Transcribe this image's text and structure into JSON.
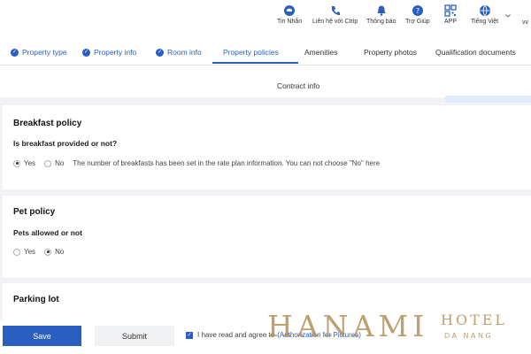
{
  "topbar": {
    "items": [
      {
        "label": "Tin Nhắn",
        "icon": "chat-icon"
      },
      {
        "label": "Liên hệ với Ctrip",
        "icon": "phone-icon"
      },
      {
        "label": "Thông báo",
        "icon": "bell-icon"
      },
      {
        "label": "Trợ Giúp",
        "icon": "help-icon"
      },
      {
        "label": "APP",
        "icon": "qr-code-icon"
      },
      {
        "label": "Tiếng Việt",
        "icon": "globe-icon"
      }
    ],
    "extra": "vv"
  },
  "tabs": [
    {
      "label": "Property type",
      "completed": true
    },
    {
      "label": "Property info",
      "completed": true
    },
    {
      "label": "Room info",
      "completed": true
    },
    {
      "label": "Property policies",
      "active": true
    },
    {
      "label": "Amenities"
    },
    {
      "label": "Property photos"
    },
    {
      "label": "Qualification documents"
    },
    {
      "label": "Contract info"
    }
  ],
  "breakfast": {
    "title": "Breakfast policy",
    "question": "Is breakfast provided or not?",
    "yes": "Yes",
    "no": "No",
    "selected": "Yes",
    "note": "The number of breakfasts has been set in the rate plan information. You can not choose \"No\" here"
  },
  "pet": {
    "title": "Pet policy",
    "question": "Pets allowed or not",
    "yes": "Yes",
    "no": "No",
    "selected": "No"
  },
  "parking": {
    "title": "Parking lot"
  },
  "footer": {
    "save": "Save",
    "submit": "Submit",
    "agree_text": "I have read and agree to",
    "agree_link": "(Authorization for Pictures)",
    "agree_checked": true
  },
  "watermark": {
    "brand": "HANAMI",
    "hotel": "HOTEL",
    "city": "DA NANG"
  },
  "colors": {
    "accent": "#2a5fc1",
    "watermark": "#b08a50"
  }
}
